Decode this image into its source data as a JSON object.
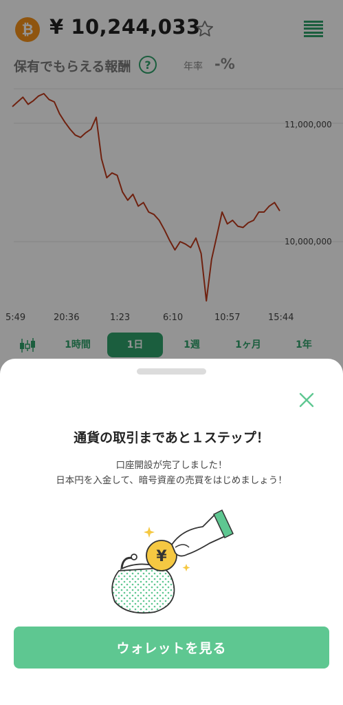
{
  "header": {
    "coin_symbol": "₿",
    "price": "¥ 10,244,033",
    "star_icon": "star-outline-icon",
    "menu_icon": "order-book-icon"
  },
  "reward": {
    "label": "保有でもらえる報酬",
    "help": "?",
    "rate_label": "年率",
    "rate_value": "-%"
  },
  "chart": {
    "y_labels": [
      "11,000,000",
      "10,000,000"
    ],
    "x_labels": [
      "5:49",
      "20:36",
      "1:23",
      "6:10",
      "10:57",
      "15:44"
    ]
  },
  "chart_data": {
    "type": "line",
    "title": "",
    "xlabel": "",
    "ylabel": "",
    "ylim": [
      9450000,
      11350000
    ],
    "x_tick_labels": [
      "5:49",
      "20:36",
      "1:23",
      "6:10",
      "10:57",
      "15:44"
    ],
    "y_tick_labels": [
      "11,000,000",
      "10,000,000"
    ],
    "series": [
      {
        "values": [
          11140000,
          11180000,
          11220000,
          11160000,
          11190000,
          11230000,
          11250000,
          11200000,
          11180000,
          11080000,
          11010000,
          10950000,
          10900000,
          10880000,
          10920000,
          10950000,
          11050000,
          10700000,
          10540000,
          10580000,
          10560000,
          10420000,
          10350000,
          10400000,
          10300000,
          10330000,
          10250000,
          10230000,
          10180000,
          10100000,
          10010000,
          9930000,
          10000000,
          9980000,
          9950000,
          10030000,
          9900000,
          9500000,
          9850000,
          10050000,
          10250000,
          10150000,
          10180000,
          10130000,
          10120000,
          10160000,
          10180000,
          10250000,
          10250000,
          10300000,
          10330000,
          10260000
        ]
      }
    ],
    "line_color": "#c0391b",
    "grid": true
  },
  "periods": {
    "candle_icon": "candlestick-icon",
    "tabs": [
      "1時間",
      "1日",
      "1週",
      "1ヶ月",
      "1年"
    ],
    "active": "1日"
  },
  "sheet": {
    "close_icon": "close-icon",
    "title": "通貨の取引まであと１ステップ！",
    "message_line1": "口座開設が完了しました！",
    "message_line2": "日本円を入金して、暗号資産の売買をはじめましょう！",
    "illustration_coin": "¥",
    "button_label": "ウォレットを見る"
  },
  "colors": {
    "accent": "#2fa36b",
    "button": "#5ec791",
    "chart_line": "#c0391b",
    "btc": "#f7931a"
  }
}
